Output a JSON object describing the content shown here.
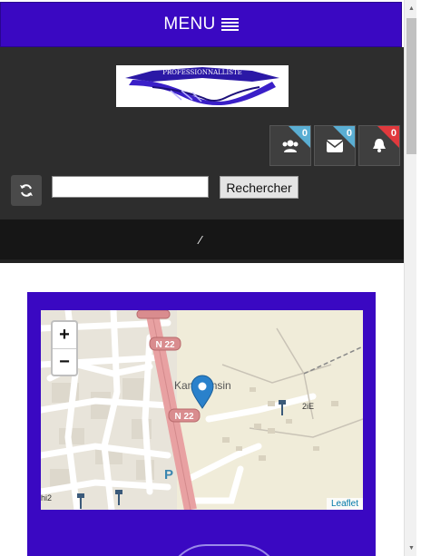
{
  "header": {
    "menu_label": "MENU"
  },
  "logo": {
    "text": "PROFESSIONNALLISTE"
  },
  "badges": [
    {
      "name": "users",
      "count": "0",
      "color": "#5aaed3"
    },
    {
      "name": "messages",
      "count": "0",
      "color": "#5aaed3"
    },
    {
      "name": "notifications",
      "count": "0",
      "color": "#e0393d"
    }
  ],
  "search": {
    "value": "",
    "button_label": "Rechercher"
  },
  "map": {
    "road_label_1": "N 22",
    "road_label_2": "N 22",
    "place_label": "Kamboinsin",
    "poi_label": "2iE",
    "edge_label": "hi2",
    "parking_label": "P",
    "zoom_in": "+",
    "zoom_out": "−",
    "attribution": "Leaflet"
  },
  "colors": {
    "brand": "#3a08c2",
    "dark": "#2d2d2d",
    "accent_blue": "#5aaed3",
    "accent_red": "#e0393d"
  }
}
